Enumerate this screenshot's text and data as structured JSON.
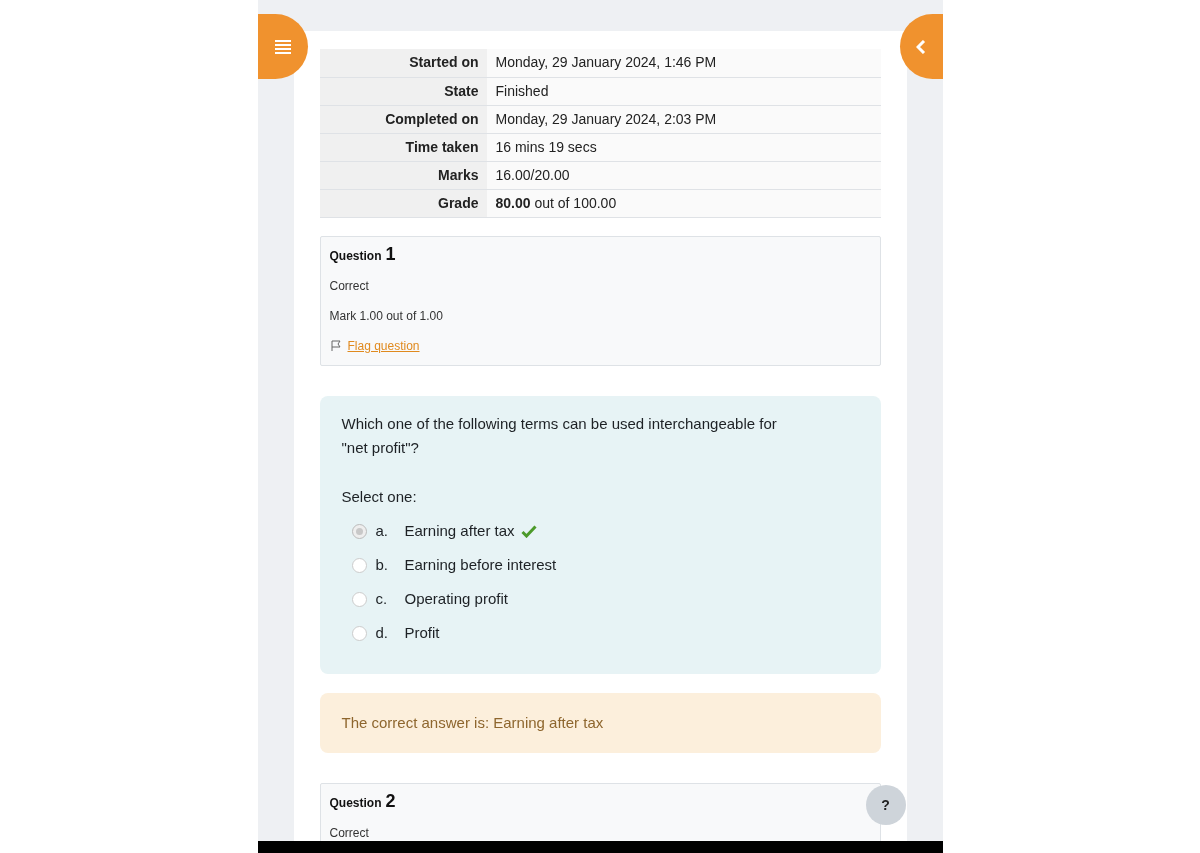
{
  "summary": [
    {
      "label": "Started on",
      "value": "Monday, 29 January 2024, 1:46 PM"
    },
    {
      "label": "State",
      "value": "Finished"
    },
    {
      "label": "Completed on",
      "value": "Monday, 29 January 2024, 2:03 PM"
    },
    {
      "label": "Time taken",
      "value": "16 mins 19 secs"
    },
    {
      "label": "Marks",
      "value": "16.00/20.00"
    },
    {
      "label": "Grade",
      "value": "**80.00** out of 100.00"
    }
  ],
  "questions": [
    {
      "label": "Question",
      "number": "1",
      "status": "Correct",
      "mark": "Mark 1.00 out of 1.00",
      "flag_link": "Flag question",
      "prompt": "Which one of the following terms can be used interchangeable for \"net profit\"?",
      "select_label": "Select one:",
      "options": [
        {
          "letter": "a.",
          "text": "Earning after tax",
          "selected": true,
          "correct": true
        },
        {
          "letter": "b.",
          "text": "Earning before interest",
          "selected": false,
          "correct": false
        },
        {
          "letter": "c.",
          "text": "Operating profit",
          "selected": false,
          "correct": false
        },
        {
          "letter": "d.",
          "text": "Profit",
          "selected": false,
          "correct": false
        }
      ],
      "feedback": "The correct answer is: Earning after tax"
    },
    {
      "label": "Question",
      "number": "2",
      "status": "Correct"
    }
  ],
  "help_button": "?"
}
